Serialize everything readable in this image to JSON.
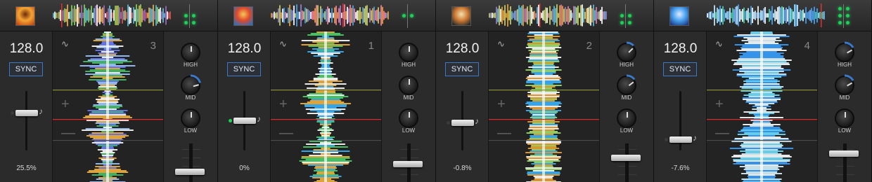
{
  "decks": [
    {
      "bpm": "128.0",
      "sync_label": "SYNC",
      "deck_number": "3",
      "pitch": "25.5%",
      "eq": {
        "high": "HIGH",
        "mid": "MID",
        "low": "LOW"
      },
      "art_colors": [
        "#c24a14",
        "#f5a533",
        "#6b2a0b"
      ],
      "theme": "multicolor",
      "pitch_pos": 0.36,
      "volume": 0.32,
      "knob_levels": [
        0.0,
        0.5,
        0.0
      ],
      "vu": [
        0,
        1,
        1
      ]
    },
    {
      "bpm": "128.0",
      "sync_label": "SYNC",
      "deck_number": "1",
      "pitch": "0%",
      "eq": {
        "high": "HIGH",
        "mid": "MID",
        "low": "LOW"
      },
      "art_colors": [
        "#2e6fb8",
        "#e0482a",
        "#f3c85a"
      ],
      "theme": "orange-blue",
      "pitch_pos": 0.5,
      "volume": 0.55,
      "knob_levels": [
        0.0,
        0.0,
        0.0
      ],
      "vu": [
        0,
        1,
        0
      ]
    },
    {
      "bpm": "128.0",
      "sync_label": "SYNC",
      "deck_number": "2",
      "pitch": "-0.8%",
      "eq": {
        "high": "HIGH",
        "mid": "MID",
        "low": "LOW"
      },
      "art_colors": [
        "#2a2a2a",
        "#d07a33",
        "#f0e2b0"
      ],
      "theme": "orange",
      "pitch_pos": 0.55,
      "volume": 0.72,
      "knob_levels": [
        0.3,
        0.35,
        0.0
      ],
      "vu": [
        0,
        1,
        1
      ]
    },
    {
      "bpm": "128.0",
      "sync_label": "SYNC",
      "deck_number": "4",
      "pitch": "-7.6%",
      "eq": {
        "high": "HIGH",
        "mid": "MID",
        "low": "LOW"
      },
      "art_colors": [
        "#1b3c8a",
        "#4aa3f0",
        "#dfe9ff"
      ],
      "theme": "blue",
      "pitch_pos": 0.86,
      "volume": 0.85,
      "knob_levels": [
        0.4,
        0.4,
        0.0
      ],
      "vu": [
        1,
        1,
        1
      ]
    }
  ],
  "icons": {
    "wave": "waveform-icon",
    "note": "music-note-icon",
    "plus": "zoom-in-icon",
    "minus": "zoom-out-icon"
  },
  "accent": "#3a78c8"
}
